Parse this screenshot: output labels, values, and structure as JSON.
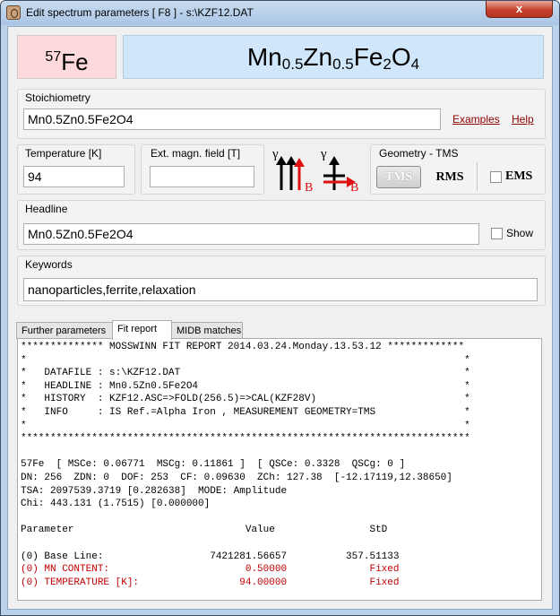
{
  "window": {
    "title": "Edit spectrum parameters [ F8 ] - s:\\KZF12.DAT",
    "close_glyph": "x"
  },
  "header": {
    "isotope_mass": "57",
    "isotope_element": "Fe",
    "formula": [
      {
        "t": "Mn",
        "sub": "0.5"
      },
      {
        "t": "Zn",
        "sub": "0.5"
      },
      {
        "t": "Fe",
        "sub": "2"
      },
      {
        "t": "O",
        "sub": "4"
      }
    ]
  },
  "stoichiometry": {
    "label": "Stoichiometry",
    "value": "Mn0.5Zn0.5Fe2O4",
    "examples_link": "Examples",
    "help_link": "Help"
  },
  "temperature": {
    "label": "Temperature [K]",
    "value": "94"
  },
  "ext_field": {
    "label": "Ext. magn. field  [T]",
    "value": ""
  },
  "gamma_icons": {
    "gamma": "γ",
    "b": "B"
  },
  "geometry": {
    "label": "Geometry - TMS",
    "tms": "TMS",
    "rms": "RMS",
    "ems": "EMS",
    "ems_checked": false
  },
  "headline": {
    "label": "Headline",
    "value": "Mn0.5Zn0.5Fe2O4",
    "show_label": "Show",
    "show_checked": false
  },
  "keywords": {
    "label": "Keywords",
    "value": "nanoparticles,ferrite,relaxation"
  },
  "tabs": [
    {
      "label": "Further parameters",
      "active": false
    },
    {
      "label": "Fit report",
      "active": true
    },
    {
      "label": "MIDB matches",
      "active": false
    }
  ],
  "report_lines": [
    {
      "text": "************** MOSSWINN FIT REPORT 2014.03.24.Monday.13.53.12 *************",
      "red": false
    },
    {
      "text": "*                                                                          *",
      "red": false
    },
    {
      "text": "*   DATAFILE : s:\\KZF12.DAT                                                *",
      "red": false
    },
    {
      "text": "*   HEADLINE : Mn0.5Zn0.5Fe2O4                                             *",
      "red": false
    },
    {
      "text": "*   HISTORY  : KZF12.ASC=>FOLD(256.5)=>CAL(KZF28V)                         *",
      "red": false
    },
    {
      "text": "*   INFO     : IS Ref.=Alpha Iron , MEASUREMENT GEOMETRY=TMS               *",
      "red": false
    },
    {
      "text": "*                                                                          *",
      "red": false
    },
    {
      "text": "****************************************************************************",
      "red": false
    },
    {
      "text": "",
      "red": false
    },
    {
      "text": "57Fe  [ MSCe: 0.06771  MSCg: 0.11861 ]  [ QSCe: 0.3328  QSCg: 0 ]",
      "red": false
    },
    {
      "text": "DN: 256  ZDN: 0  DOF: 253  CF: 0.09630  ZCh: 127.38  [-12.17119,12.38650]",
      "red": false
    },
    {
      "text": "TSA: 2097539.3719 [0.282638]  MODE: Amplitude",
      "red": false
    },
    {
      "text": "Chi: 443.131 (1.7515) [0.000000]",
      "red": false
    },
    {
      "text": "",
      "red": false
    },
    {
      "text": "Parameter                             Value                StD",
      "red": false
    },
    {
      "text": "",
      "red": false
    },
    {
      "text": "(0) Base Line:                  7421281.56657          357.51133",
      "red": false
    },
    {
      "text": "(0) MN CONTENT:                       0.50000              Fixed",
      "red": true
    },
    {
      "text": "(0) TEMPERATURE [K]:                 94.00000              Fixed",
      "red": true
    }
  ]
}
